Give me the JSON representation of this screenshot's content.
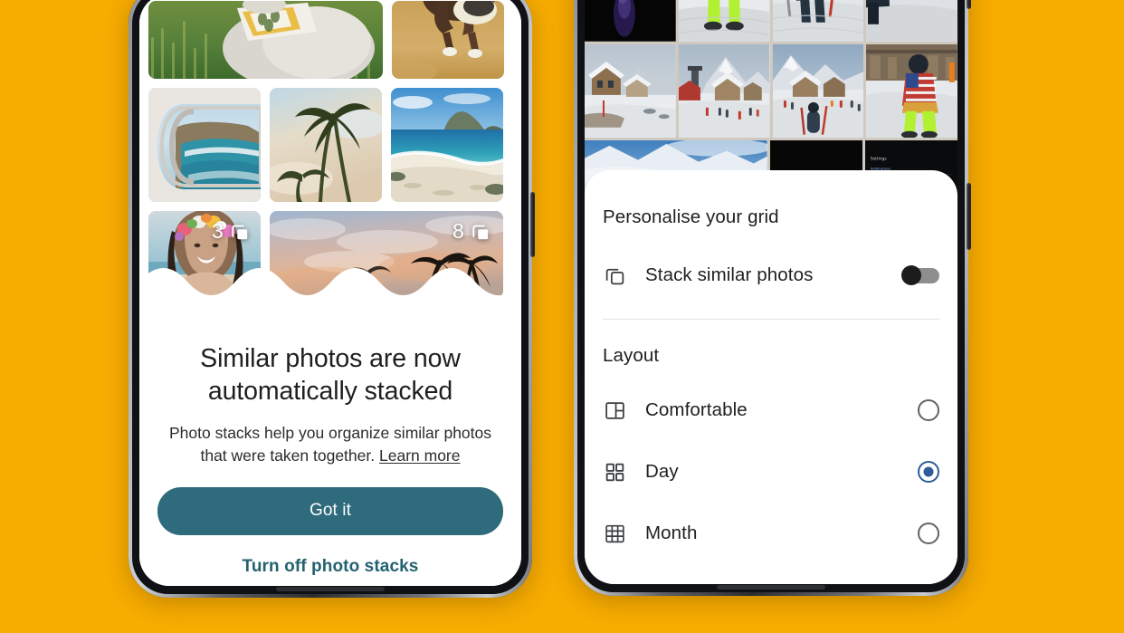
{
  "background_color": "#F7AC00",
  "left_phone": {
    "name": "google-photos-stacking-promo",
    "photo_grid": {
      "stack_badges": [
        {
          "count": "3",
          "icon": "stack-icon"
        },
        {
          "count": "8",
          "icon": "stack-icon"
        }
      ],
      "tiles": [
        {
          "name": "dog-in-grass-photo"
        },
        {
          "name": "dog-running-sand-photo"
        },
        {
          "name": "airplane-window-coast-photo"
        },
        {
          "name": "palm-trees-sky-photo"
        },
        {
          "name": "beach-cove-photo"
        },
        {
          "name": "woman-flower-crown-photo"
        },
        {
          "name": "sunset-palms-photo"
        }
      ]
    },
    "dialog": {
      "title": "Similar photos are now automatically stacked",
      "body_text": "Photo stacks help you organize similar photos that were taken together.",
      "learn_more_label": "Learn more",
      "primary_button_label": "Got it",
      "secondary_button_label": "Turn off photo stacks",
      "primary_button_color": "#2E6B7C",
      "secondary_button_color": "#24616F"
    }
  },
  "right_phone": {
    "name": "google-photos-grid-settings",
    "photo_grid": {
      "tiles": [
        {
          "name": "dark-night-photo"
        },
        {
          "name": "skier-green-pants-photo"
        },
        {
          "name": "skier-poles-photo"
        },
        {
          "name": "alpine-chalet-snow-photo"
        },
        {
          "name": "ski-village-mountain-photo"
        },
        {
          "name": "ski-resort-crowd-photo"
        },
        {
          "name": "skier-flag-jacket-photo"
        },
        {
          "name": "snowy-mountain-ridge-photo"
        },
        {
          "name": "screenshot-dark-ui-photo"
        },
        {
          "name": "screenshot-settings-photo"
        }
      ]
    },
    "sheet": {
      "personalise_title": "Personalise your grid",
      "stack_option": {
        "label": "Stack similar photos",
        "icon": "stack-icon",
        "toggle_state": "off"
      },
      "layout_title": "Layout",
      "layout_options": [
        {
          "label": "Comfortable",
          "icon": "layout-comfortable-icon",
          "selected": false
        },
        {
          "label": "Day",
          "icon": "layout-day-icon",
          "selected": true
        },
        {
          "label": "Month",
          "icon": "layout-month-icon",
          "selected": false
        }
      ],
      "selected_accent_color": "#2F5B9B"
    }
  }
}
